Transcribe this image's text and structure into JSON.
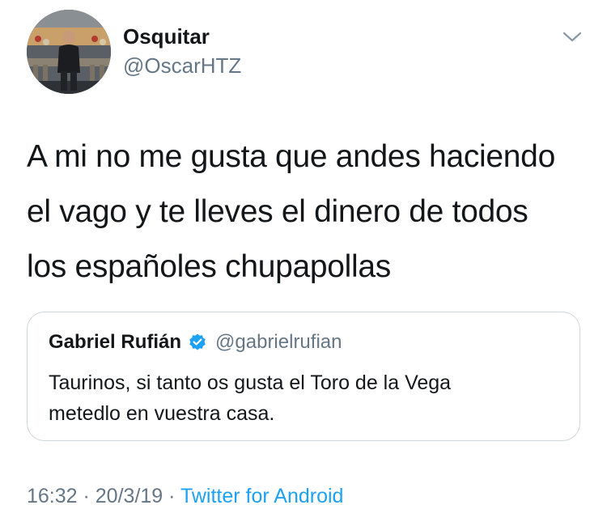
{
  "author": {
    "display_name": "Osquitar",
    "handle": "@OscarHTZ",
    "avatar_icon": "profile-photo"
  },
  "tweet": {
    "lines": [
      "A mi no me gusta que andes haciendo",
      "el vago y te lleves el dinero de todos",
      "los españoles chupapollas"
    ]
  },
  "quoted": {
    "display_name": "Gabriel Rufián",
    "handle": "@gabrielrufian",
    "verified": true,
    "lines": [
      "Taurinos, si tanto os gusta el Toro de la Vega",
      "metedlo en vuestra casa."
    ]
  },
  "meta": {
    "time": "16:32",
    "separator_1": " · ",
    "date": "20/3/19",
    "separator_2": " · ",
    "source": "Twitter for Android"
  },
  "colors": {
    "text": "#14171a",
    "secondary": "#657786",
    "link": "#1da1f2",
    "border": "#ccd6dd",
    "verified": "#1da1f2"
  }
}
